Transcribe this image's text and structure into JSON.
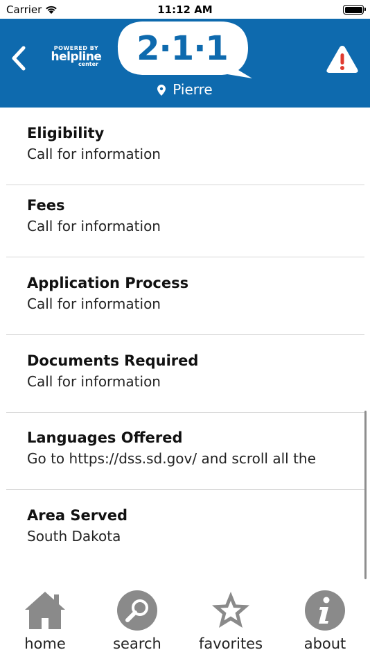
{
  "status_bar": {
    "carrier": "Carrier",
    "time": "11:12 AM"
  },
  "header": {
    "logo_powered_by": "POWERED BY",
    "logo_helpline": "helpline",
    "logo_center": "center",
    "brand_number": "2·1·1",
    "location": "Pierre",
    "back_icon": "chevron-left-icon",
    "alert_icon": "warning-triangle-icon",
    "color_primary": "#0e6aae",
    "color_alert": "#e03a2f"
  },
  "details": [
    {
      "title": "Eligibility",
      "value": "Call for information"
    },
    {
      "title": "Fees",
      "value": "Call for information"
    },
    {
      "title": "Application Process",
      "value": "Call for information"
    },
    {
      "title": "Documents Required",
      "value": "Call for information"
    },
    {
      "title": "Languages Offered",
      "value": "Go to https://dss.sd.gov/ and scroll all the"
    },
    {
      "title": "Area Served",
      "value": "South Dakota"
    }
  ],
  "tabs": [
    {
      "label": "home",
      "icon": "home-icon"
    },
    {
      "label": "search",
      "icon": "search-icon"
    },
    {
      "label": "favorites",
      "icon": "star-icon"
    },
    {
      "label": "about",
      "icon": "info-icon"
    }
  ]
}
